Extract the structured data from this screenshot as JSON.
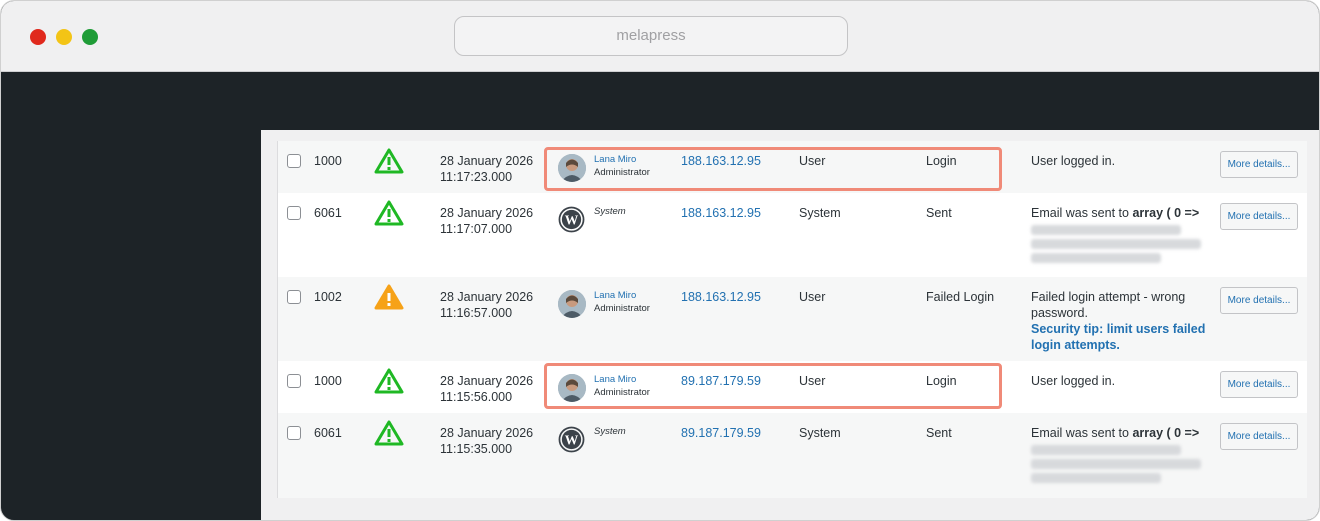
{
  "browser": {
    "url": "melapress"
  },
  "ui": {
    "more_details": "More details...",
    "security_tip": "Security tip: limit users failed login attempts."
  },
  "colors": {
    "accent": "#2271b1",
    "highlight": "#f08a78",
    "severity_ok": "#1fb824",
    "severity_warn": "#f6a218"
  },
  "rows": [
    {
      "id": "1000",
      "severity": "green-warning-icon",
      "date": "28 January 2026",
      "time": "11:17:23.000",
      "user_name": "Lana Miro",
      "user_role": "Administrator",
      "ip": "188.163.12.95",
      "object": "User",
      "event": "Login",
      "message": "User logged in."
    },
    {
      "id": "6061",
      "severity": "green-warning-icon",
      "date": "28 January 2026",
      "time": "11:17:07.000",
      "user_name": "System",
      "ip": "188.163.12.95",
      "object": "System",
      "event": "Sent",
      "message_prefix": "Email was sent to ",
      "message_bold": "array ( 0 =>"
    },
    {
      "id": "1002",
      "severity": "orange-warning-icon",
      "date": "28 January 2026",
      "time": "11:16:57.000",
      "user_name": "Lana Miro",
      "user_role": "Administrator",
      "ip": "188.163.12.95",
      "object": "User",
      "event": "Failed Login",
      "message": "Failed login attempt - wrong password."
    },
    {
      "id": "1000",
      "severity": "green-warning-icon",
      "date": "28 January 2026",
      "time": "11:15:56.000",
      "user_name": "Lana Miro",
      "user_role": "Administrator",
      "ip": "89.187.179.59",
      "object": "User",
      "event": "Login",
      "message": "User logged in."
    },
    {
      "id": "6061",
      "severity": "green-warning-icon",
      "date": "28 January 2026",
      "time": "11:15:35.000",
      "user_name": "System",
      "ip": "89.187.179.59",
      "object": "System",
      "event": "Sent",
      "message_prefix": "Email was sent to ",
      "message_bold": "array ( 0 =>"
    }
  ]
}
